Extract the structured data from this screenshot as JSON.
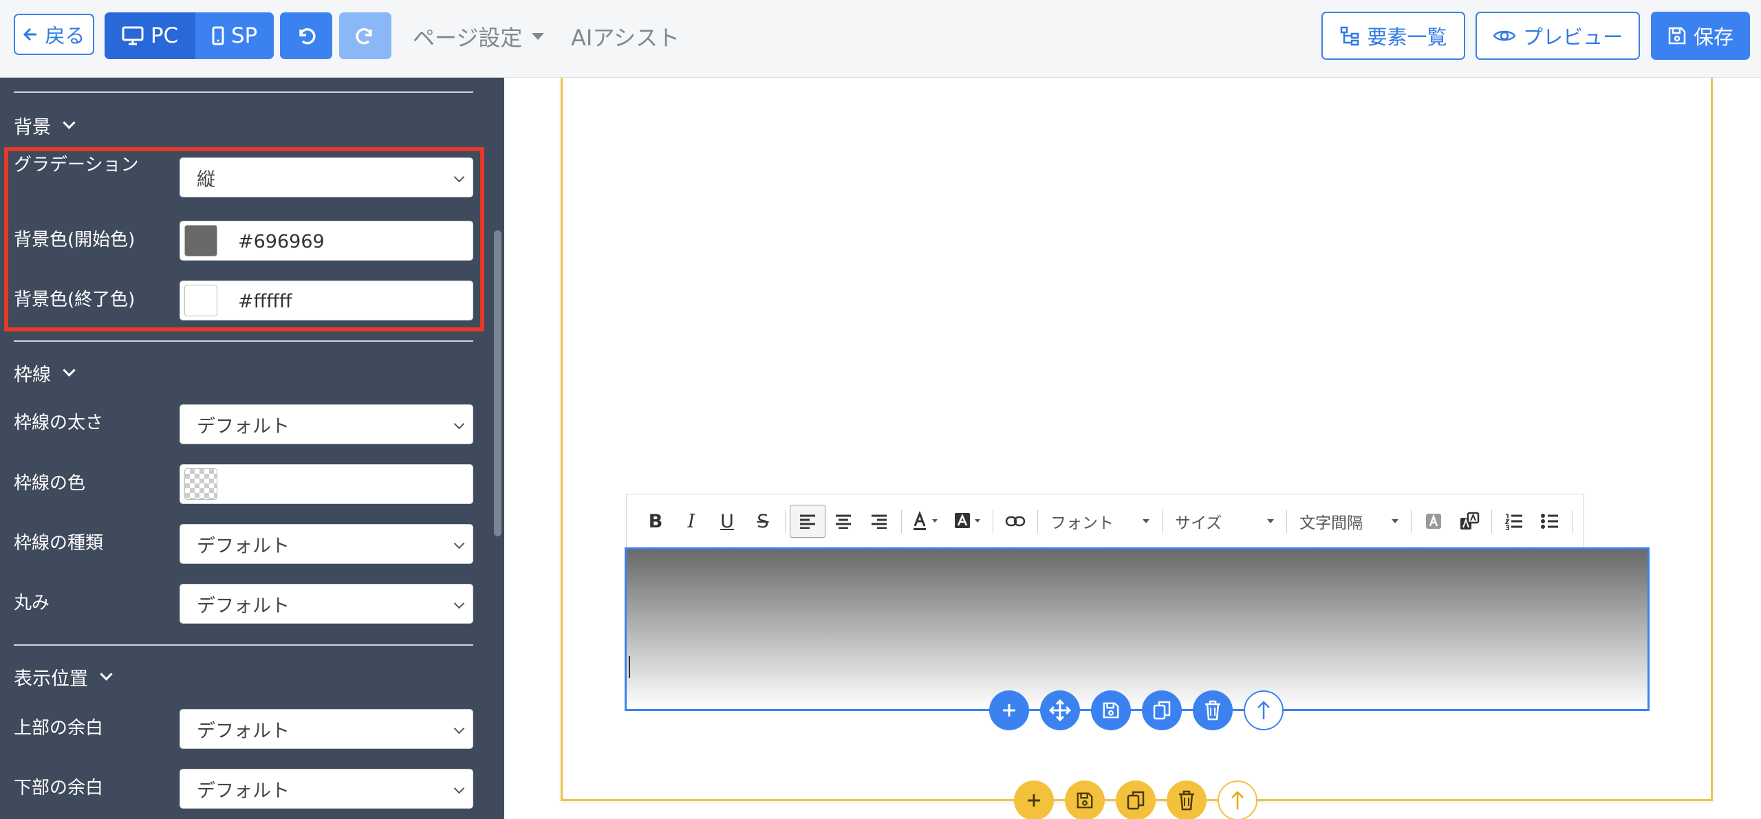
{
  "topbar": {
    "back_label": "戻る",
    "pc_label": "PC",
    "sp_label": "SP",
    "page_settings": "ページ設定",
    "ai_assist": "AIアシスト",
    "elements_list": "要素一覧",
    "preview": "プレビュー",
    "save": "保存"
  },
  "sidebar": {
    "background": {
      "title": "背景",
      "gradient_label": "グラデーション",
      "gradient_value": "縦",
      "start_color_label": "背景色(開始色)",
      "start_color_value": "#696969",
      "end_color_label": "背景色(終了色)",
      "end_color_value": "#ffffff"
    },
    "border": {
      "title": "枠線",
      "width_label": "枠線の太さ",
      "width_value": "デフォルト",
      "color_label": "枠線の色",
      "type_label": "枠線の種類",
      "type_value": "デフォルト",
      "radius_label": "丸み",
      "radius_value": "デフォルト"
    },
    "position": {
      "title": "表示位置",
      "top_margin_label": "上部の余白",
      "top_margin_value": "デフォルト",
      "bottom_margin_label": "下部の余白",
      "bottom_margin_value": "デフォルト"
    }
  },
  "editor": {
    "toolbar": {
      "bold": "B",
      "italic": "I",
      "underline": "U",
      "strike": "S",
      "font": "フォント",
      "size": "サイズ",
      "letter_spacing": "文字間隔"
    }
  },
  "colors": {
    "accent": "#3b82f0",
    "sidebar_bg": "#3f4a5c",
    "highlight": "#e4392b",
    "page_frame": "#f1c24b"
  }
}
